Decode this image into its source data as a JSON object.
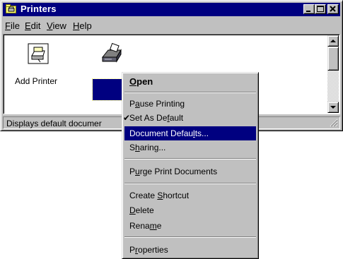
{
  "window": {
    "title": "Printers",
    "menu": [
      {
        "label": "File",
        "mnemonic": "F",
        "rest": "ile"
      },
      {
        "label": "Edit",
        "mnemonic": "E",
        "rest": "dit"
      },
      {
        "label": "View",
        "mnemonic": "V",
        "rest": "iew"
      },
      {
        "label": "Help",
        "mnemonic": "H",
        "rest": "elp"
      }
    ],
    "icons": {
      "add_printer": "Add Printer"
    },
    "status_text": "Displays default documer"
  },
  "context_menu": {
    "items": {
      "open": {
        "pre": "",
        "mn": "O",
        "post": "pen"
      },
      "pause": {
        "pre": "P",
        "mn": "a",
        "post": "use Printing"
      },
      "set_default": {
        "pre": "Set As De",
        "mn": "f",
        "post": "ault"
      },
      "doc_defaults": {
        "pre": "Document Defau",
        "mn": "l",
        "post": "ts..."
      },
      "sharing": {
        "pre": "S",
        "mn": "h",
        "post": "aring..."
      },
      "purge": {
        "pre": "P",
        "mn": "u",
        "post": "rge Print Documents"
      },
      "shortcut": {
        "pre": "Create ",
        "mn": "S",
        "post": "hortcut"
      },
      "delete": {
        "pre": "",
        "mn": "D",
        "post": "elete"
      },
      "rename": {
        "pre": "Rena",
        "mn": "m",
        "post": "e"
      },
      "properties": {
        "pre": "P",
        "mn": "r",
        "post": "operties"
      }
    },
    "check_mark": "✔"
  },
  "colors": {
    "titlebar": "#000080",
    "face": "#c0c0c0",
    "highlight": "#000080"
  }
}
